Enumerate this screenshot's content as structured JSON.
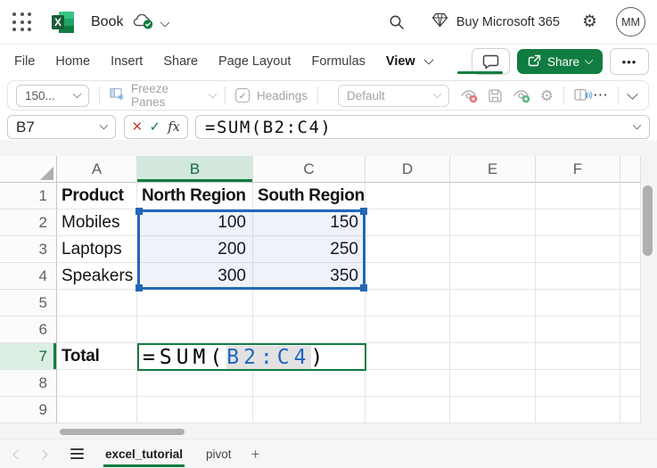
{
  "topbar": {
    "title": "Book",
    "buy_label": "Buy Microsoft 365",
    "avatar_initials": "MM"
  },
  "menubar": {
    "file": "File",
    "home": "Home",
    "insert": "Insert",
    "share": "Share",
    "page_layout": "Page Layout",
    "formulas": "Formulas",
    "view": "View",
    "active_item": "View",
    "share_button": "Share"
  },
  "toolbar": {
    "zoom_value": "150...",
    "freeze_panes": "Freeze Panes",
    "headings": "Headings",
    "style_value": "Default"
  },
  "formula_bar": {
    "name_box": "B7",
    "fx_label": "fx",
    "formula": "=SUM(B2:C4)"
  },
  "icons": {
    "cancel_glyph": "×",
    "confirm_glyph": "✓",
    "check_glyph": "✓",
    "gear_glyph": "⚙",
    "more_horizontal": "⋯",
    "more_dots": "•••",
    "add_sheet": "+"
  },
  "grid": {
    "col_headers": [
      "A",
      "B",
      "C",
      "D",
      "E",
      "F"
    ],
    "active_col": "B",
    "row_headers": [
      "1",
      "2",
      "3",
      "4",
      "5",
      "6",
      "7",
      "8",
      "9"
    ],
    "active_row": "7",
    "rows": {
      "r1": {
        "a": "Product",
        "b": "North Region",
        "c": "South Region"
      },
      "r2": {
        "a": "Mobiles",
        "b": "100",
        "c": "150"
      },
      "r3": {
        "a": "Laptops",
        "b": "200",
        "c": "250"
      },
      "r4": {
        "a": "Speakers",
        "b": "300",
        "c": "350"
      },
      "r7": {
        "a": "Total"
      }
    },
    "selection_range": "B2:C4",
    "editing_cell": {
      "cell": "B7",
      "prefix": "=SUM(",
      "ref": "B2:C4",
      "suffix": ")"
    }
  },
  "sheet_bar": {
    "tabs": [
      {
        "label": "excel_tutorial"
      },
      {
        "label": "pivot"
      }
    ],
    "active_tab": "excel_tutorial"
  },
  "colors": {
    "accent_green": "#107C41",
    "selection_blue": "#2268B8",
    "reference_blue": "#2166C0"
  }
}
